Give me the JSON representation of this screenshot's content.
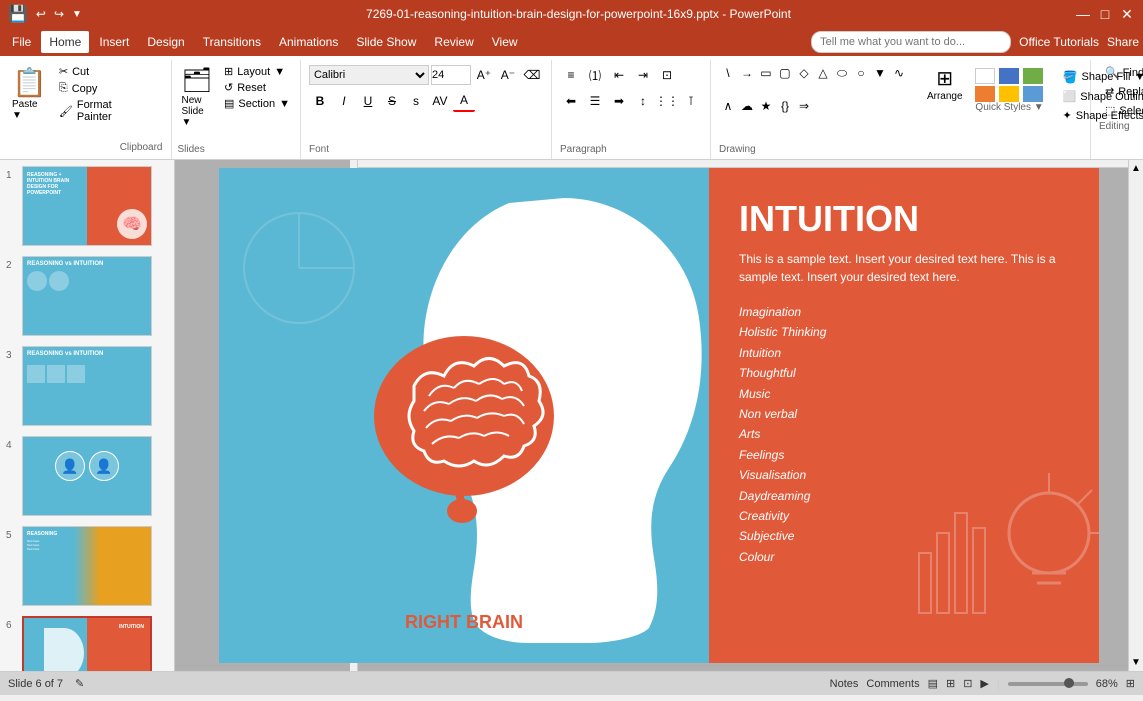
{
  "titlebar": {
    "title": "7269-01-reasoning-intuition-brain-design-for-powerpoint-16x9.pptx - PowerPoint",
    "save_icon": "💾",
    "undo_icon": "↩",
    "redo_icon": "↪",
    "customize_icon": "▼",
    "min_btn": "—",
    "max_btn": "□",
    "close_btn": "✕"
  },
  "menubar": {
    "items": [
      "File",
      "Home",
      "Insert",
      "Design",
      "Transitions",
      "Animations",
      "Slide Show",
      "Review",
      "View"
    ],
    "active": "Home",
    "search_placeholder": "Tell me what you want to do...",
    "office_tutorials": "Office Tutorials",
    "share": "Share"
  },
  "ribbon": {
    "clipboard": {
      "label": "Clipboard",
      "paste": "Paste",
      "cut": "Cut",
      "copy": "Copy",
      "format_painter": "Format Painter"
    },
    "slides": {
      "label": "Slides",
      "new_slide": "New Slide",
      "layout": "Layout",
      "reset": "Reset",
      "section": "Section"
    },
    "font": {
      "label": "Font",
      "name": "Calibri",
      "size": "24",
      "bold": "B",
      "italic": "I",
      "underline": "U",
      "strikethrough": "S",
      "shadow": "s",
      "color": "A"
    },
    "paragraph": {
      "label": "Paragraph"
    },
    "drawing": {
      "label": "Drawing",
      "arrange": "Arrange",
      "quick_styles": "Quick Styles",
      "shape_fill": "Shape Fill",
      "shape_outline": "Shape Outline",
      "shape_effects": "Shape Effects"
    },
    "editing": {
      "label": "Editing",
      "find": "Find",
      "replace": "Replace",
      "select": "Select"
    }
  },
  "slides": [
    {
      "num": "1",
      "active": false
    },
    {
      "num": "2",
      "active": false
    },
    {
      "num": "3",
      "active": false
    },
    {
      "num": "4",
      "active": false
    },
    {
      "num": "5",
      "active": false
    },
    {
      "num": "6",
      "active": true
    }
  ],
  "slide": {
    "left_bg": "#5bb8d4",
    "right_bg": "#e05a3a",
    "title": "INTUITION",
    "description": "This is a sample text. Insert your desired text  here. This is a sample text. Insert your desired text here.",
    "list_items": [
      "Imagination",
      "Holistic Thinking",
      "Intuition",
      "Thoughtful",
      "Music",
      "Non verbal",
      "Arts",
      "Feelings",
      "Visualisation",
      "Daydreaming",
      "Creativity",
      "Subjective",
      "Colour"
    ],
    "right_brain_label": "RIGHT BRAIN"
  },
  "statusbar": {
    "slide_info": "Slide 6 of 7",
    "notes": "Notes",
    "comments": "Comments",
    "zoom": "68%"
  }
}
